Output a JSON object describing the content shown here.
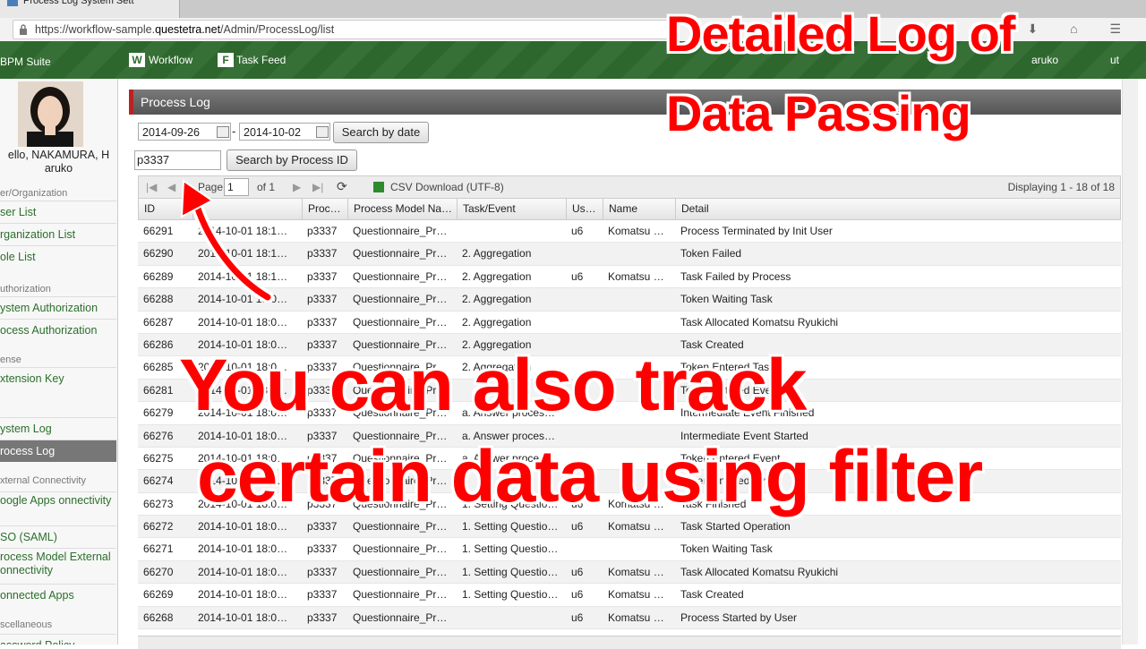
{
  "browser": {
    "tab_title": "Process Log System Sett",
    "url_prefix": "https://workflow-sample.",
    "url_domain": "questetra.net",
    "url_path": "/Admin/ProcessLog/list"
  },
  "header": {
    "brand": "BPM Suite",
    "workflow": "Workflow",
    "task_feed": "Task Feed",
    "user_fragment": "aruko",
    "logout_fragment": "ut"
  },
  "sidebar": {
    "hello": "ello, NAKAMURA, H aruko",
    "sections": [
      {
        "label": "er/Organization"
      },
      {
        "label": "uthorization"
      },
      {
        "label": "ense"
      },
      {
        "label": ""
      },
      {
        "label": "xternal Connectivity"
      },
      {
        "label": "scellaneous"
      }
    ],
    "items": [
      {
        "label": "ser List"
      },
      {
        "label": "rganization List"
      },
      {
        "label": "ole List"
      },
      {
        "label": "ystem Authorization"
      },
      {
        "label": "ocess Authorization"
      },
      {
        "label": "xtension Key"
      },
      {
        "label": "ystem Log"
      },
      {
        "label": "rocess Log"
      },
      {
        "label": "oogle Apps onnectivity"
      },
      {
        "label": "SO (SAML)"
      },
      {
        "label": "rocess Model External onnectivity"
      },
      {
        "label": "onnected Apps"
      },
      {
        "label": "assword Policy"
      }
    ]
  },
  "panel": {
    "title": "Process Log"
  },
  "search": {
    "date_from": "2014-09-26",
    "date_sep": "-",
    "date_to": "2014-10-02",
    "search_by_date": "Search by date",
    "process_id": "p3337",
    "search_by_pid": "Search by Process ID"
  },
  "toolbar": {
    "page_label": "Page",
    "page_value": "1",
    "of_pages": "of 1",
    "csv": "CSV Download (UTF-8)",
    "displaying": "Displaying 1 - 18 of 18"
  },
  "table": {
    "columns": [
      "ID",
      "",
      "Proc…",
      "Process Model Na…",
      "Task/Event",
      "Us…",
      "Name",
      "Detail"
    ],
    "rows": [
      {
        "id": "66291",
        "date": "2014-10-01 18:1…",
        "proc": "p3337",
        "model": "Questionnaire_Pr…",
        "task": "",
        "user": "u6",
        "name": "Komatsu …",
        "detail": "Process Terminated by Init User"
      },
      {
        "id": "66290",
        "date": "2014-10-01 18:1…",
        "proc": "p3337",
        "model": "Questionnaire_Pr…",
        "task": "2. Aggregation",
        "user": "",
        "name": "",
        "detail": "Token Failed"
      },
      {
        "id": "66289",
        "date": "2014-10-01 18:1…",
        "proc": "p3337",
        "model": "Questionnaire_Pr…",
        "task": "2. Aggregation",
        "user": "u6",
        "name": "Komatsu …",
        "detail": "Task Failed by Process"
      },
      {
        "id": "66288",
        "date": "2014-10-01 18:0…",
        "proc": "p3337",
        "model": "Questionnaire_Pr…",
        "task": "2. Aggregation",
        "user": "",
        "name": "",
        "detail": "Token Waiting Task"
      },
      {
        "id": "66287",
        "date": "2014-10-01 18:0…",
        "proc": "p3337",
        "model": "Questionnaire_Pr…",
        "task": "2. Aggregation",
        "user": "",
        "name": "",
        "detail": "Task Allocated Komatsu Ryukichi"
      },
      {
        "id": "66286",
        "date": "2014-10-01 18:0…",
        "proc": "p3337",
        "model": "Questionnaire_Pr…",
        "task": "2. Aggregation",
        "user": "",
        "name": "",
        "detail": "Task Created"
      },
      {
        "id": "66285",
        "date": "2014-10-01 18:0…",
        "proc": "p3337",
        "model": "Questionnaire_Pr…",
        "task": "2. Aggregation",
        "user": "",
        "name": "",
        "detail": "Token Entered Task"
      },
      {
        "id": "66281",
        "date": "2014-10-01 18:0…",
        "proc": "p3337",
        "model": "Questionnaire_Pr…",
        "task": "",
        "user": "",
        "name": "",
        "detail": "Token Entered Event"
      },
      {
        "id": "66279",
        "date": "2014-10-01 18:0…",
        "proc": "p3337",
        "model": "Questionnaire_Pr…",
        "task": "a. Answer proces…",
        "user": "",
        "name": "",
        "detail": "Intermediate Event Finished"
      },
      {
        "id": "66276",
        "date": "2014-10-01 18:0…",
        "proc": "p3337",
        "model": "Questionnaire_Pr…",
        "task": "a. Answer proces…",
        "user": "",
        "name": "",
        "detail": "Intermediate Event Started"
      },
      {
        "id": "66275",
        "date": "2014-10-01 18:0…",
        "proc": "p3337",
        "model": "Questionnaire_Pr…",
        "task": "a. Answer proces…",
        "user": "",
        "name": "",
        "detail": "Token Entered Event"
      },
      {
        "id": "66274",
        "date": "2014-10-01 18:0…",
        "proc": "p3337",
        "model": "Questionnaire_Pr…",
        "task": "",
        "user": "",
        "name": "",
        "detail": "Token Entered Event"
      },
      {
        "id": "66273",
        "date": "2014-10-01 18:0…",
        "proc": "p3337",
        "model": "Questionnaire_Pr…",
        "task": "1. Setting Questio…",
        "user": "u6",
        "name": "Komatsu …",
        "detail": "Task Finished"
      },
      {
        "id": "66272",
        "date": "2014-10-01 18:0…",
        "proc": "p3337",
        "model": "Questionnaire_Pr…",
        "task": "1. Setting Questio…",
        "user": "u6",
        "name": "Komatsu …",
        "detail": "Task Started Operation"
      },
      {
        "id": "66271",
        "date": "2014-10-01 18:0…",
        "proc": "p3337",
        "model": "Questionnaire_Pr…",
        "task": "1. Setting Questio…",
        "user": "",
        "name": "",
        "detail": "Token Waiting Task"
      },
      {
        "id": "66270",
        "date": "2014-10-01 18:0…",
        "proc": "p3337",
        "model": "Questionnaire_Pr…",
        "task": "1. Setting Questio…",
        "user": "u6",
        "name": "Komatsu …",
        "detail": "Task Allocated Komatsu Ryukichi"
      },
      {
        "id": "66269",
        "date": "2014-10-01 18:0…",
        "proc": "p3337",
        "model": "Questionnaire_Pr…",
        "task": "1. Setting Questio…",
        "user": "u6",
        "name": "Komatsu …",
        "detail": "Task Created"
      },
      {
        "id": "66268",
        "date": "2014-10-01 18:0…",
        "proc": "p3337",
        "model": "Questionnaire_Pr…",
        "task": "",
        "user": "u6",
        "name": "Komatsu …",
        "detail": "Process Started by User"
      }
    ]
  },
  "overlay": {
    "title_line1": "Detailed Log of",
    "title_line2": "Data Passing",
    "caption_line1": "You can also track",
    "caption_line2": "certain data using filter"
  },
  "colors": {
    "header_green": "#2f6b2f",
    "overlay_red": "#ff0000",
    "link_green": "#2b6f2b"
  }
}
